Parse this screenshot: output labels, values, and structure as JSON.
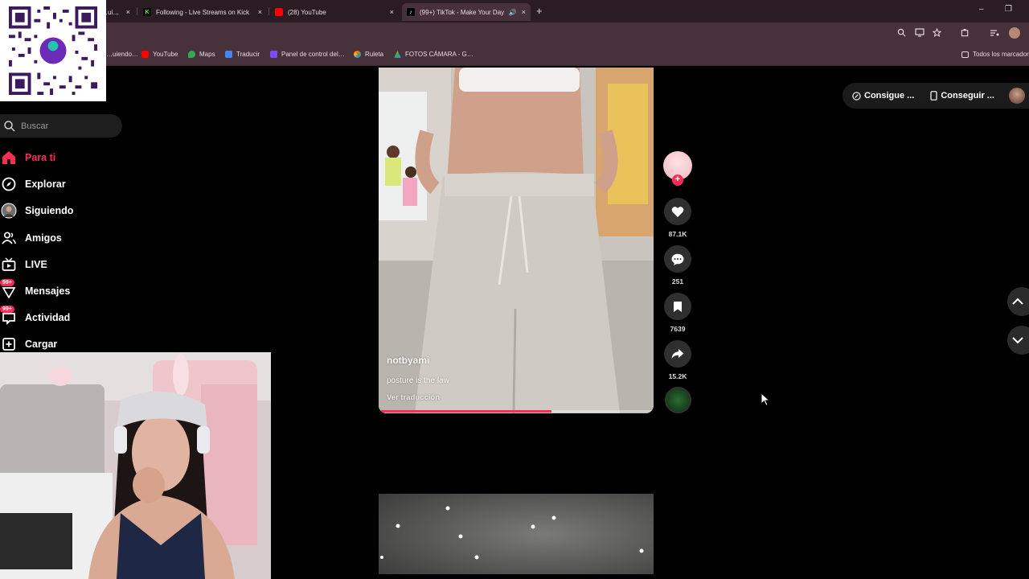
{
  "browser": {
    "tabs": [
      {
        "title": "…uiendo…",
        "close": "×"
      },
      {
        "title": "Following - Live Streams on Kick",
        "close": "×"
      },
      {
        "title": "(28) YouTube",
        "close": "×"
      },
      {
        "title": "(99+) TikTok - Make Your Day",
        "close": "×",
        "active": true
      }
    ],
    "new_tab": "+",
    "window": {
      "minimize": "–",
      "restore": "❐"
    },
    "bookmarks": [
      {
        "label": "…uiendo…"
      },
      {
        "label": "YouTube",
        "color": "#ff0000"
      },
      {
        "label": "Maps",
        "color": "#34a853"
      },
      {
        "label": "Traducir",
        "color": "#4285f4"
      },
      {
        "label": "Panel de control del…",
        "color": "#7b4cff"
      },
      {
        "label": "Ruleta",
        "color": "#ff6d00"
      },
      {
        "label": "FOTOS CÁMARA - G…",
        "color": "#fbbc04"
      }
    ],
    "bookmarks_folder": "Todos los marcadores"
  },
  "sidebar": {
    "search_placeholder": "Buscar",
    "items": [
      {
        "label": "Para ti",
        "icon": "home-icon",
        "active": true
      },
      {
        "label": "Explorar",
        "icon": "compass-icon"
      },
      {
        "label": "Siguiendo",
        "icon": "following-avatar-icon"
      },
      {
        "label": "Amigos",
        "icon": "friends-icon"
      },
      {
        "label": "LIVE",
        "icon": "live-tv-icon"
      },
      {
        "label": "Mensajes",
        "icon": "messages-icon",
        "badge": "99+"
      },
      {
        "label": "Actividad",
        "icon": "activity-icon",
        "badge": "99+"
      },
      {
        "label": "Cargar",
        "icon": "upload-plus-icon"
      }
    ]
  },
  "video": {
    "author": "notbyami",
    "caption": "posture is the law",
    "translate": "Ver traducción",
    "progress": 0.63
  },
  "actions": {
    "likes": "87.1K",
    "comments": "251",
    "saves": "7639",
    "shares": "15.2K",
    "follow": "+"
  },
  "topbar": {
    "coins": "Consigue ...",
    "app": "Conseguir ..."
  },
  "colors": {
    "accent": "#fe2c55",
    "chrome_tab_bar": "#2b1b22",
    "chrome_toolbar": "#47323b"
  }
}
